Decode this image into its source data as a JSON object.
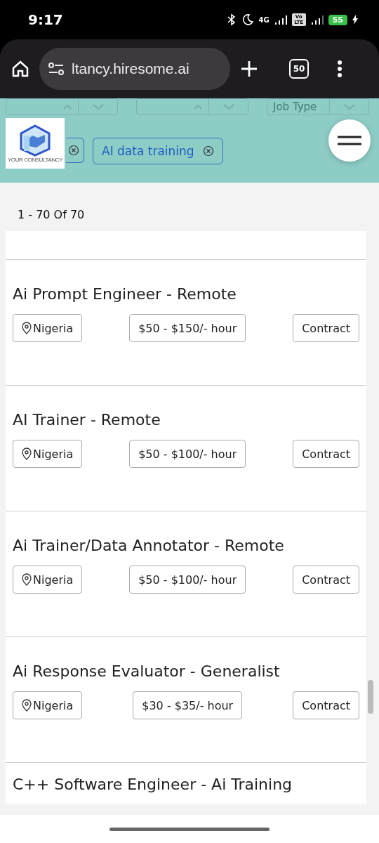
{
  "status_bar": {
    "time": "9:17",
    "network": "4G",
    "volte": "Vo LTE",
    "battery": "55"
  },
  "browser": {
    "url": "ltancy.hiresome.ai",
    "tab_count": "50"
  },
  "filters": {
    "dropdowns": [
      {
        "clearable": true
      },
      {
        "clearable": true
      },
      {
        "clearable": false,
        "placeholder": "Job Type"
      }
    ],
    "chips": [
      {
        "partial": true
      },
      {
        "partial": false,
        "label": "AI data training"
      }
    ],
    "logo_text": "YOUR CONSULTANCY"
  },
  "results_count": "1 - 70 Of 70",
  "jobs": [
    {
      "title": "Ai Prompt Engineer - Remote",
      "location": "Nigeria",
      "pay": "$50 - $150/- hour",
      "type": "Contract"
    },
    {
      "title": "AI Trainer - Remote",
      "location": "Nigeria",
      "pay": "$50 - $100/- hour",
      "type": "Contract"
    },
    {
      "title": "Ai Trainer/Data Annotator - Remote",
      "location": "Nigeria",
      "pay": "$50 - $100/- hour",
      "type": "Contract"
    },
    {
      "title": "Ai Response Evaluator - Generalist",
      "location": "Nigeria",
      "pay": "$30 - $35/- hour",
      "type": "Contract"
    },
    {
      "title": "C++ Software Engineer - Ai Training"
    }
  ]
}
